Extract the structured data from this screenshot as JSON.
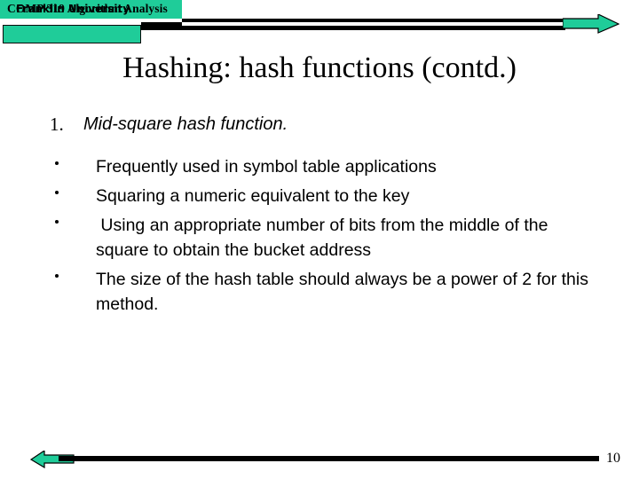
{
  "header": {
    "course_banner": "COMP 319 Algorithm Analysis",
    "school_banner": "Franklin University",
    "arrow_icon": "arrow-right-icon"
  },
  "title": "Hashing: hash functions (contd.)",
  "content": {
    "numbered": [
      {
        "marker": "1.",
        "text": "Mid-square hash function."
      }
    ],
    "bullets": [
      "Frequently used in symbol table applications",
      "Squaring a numeric equivalent to the key",
      " Using an appropriate number of bits from the middle of the square to obtain the bucket address",
      "The size of the hash table should always be a power of 2 for this method."
    ]
  },
  "footer": {
    "arrow_icon": "arrow-left-icon",
    "page_number": "10"
  },
  "colors": {
    "accent_green": "#1FCC99",
    "rule_black": "#000000",
    "background": "#FFFFFF",
    "text": "#000000"
  }
}
